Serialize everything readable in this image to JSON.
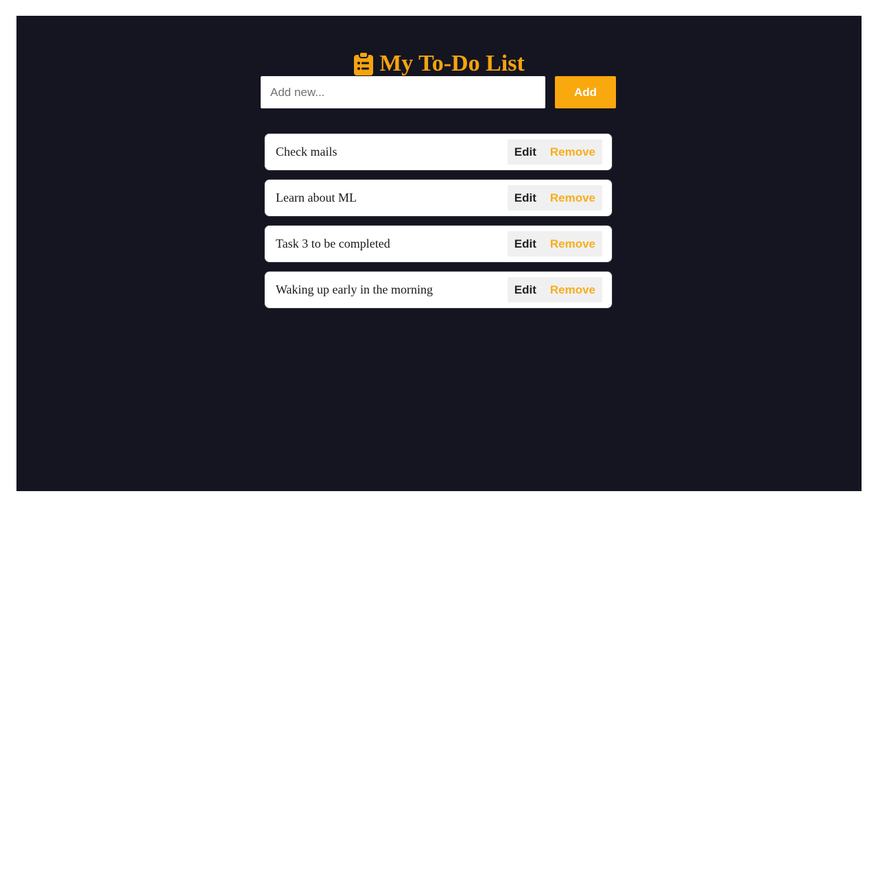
{
  "app": {
    "title": "My To-Do List",
    "title_icon": "clipboard-list-icon",
    "accent_color": "#f5a30f",
    "background_color": "#141520"
  },
  "add_form": {
    "placeholder": "Add new...",
    "value": "",
    "button_label": "Add"
  },
  "todos": [
    {
      "text": "Check mails",
      "edit_label": "Edit",
      "remove_label": "Remove"
    },
    {
      "text": "Learn about ML",
      "edit_label": "Edit",
      "remove_label": "Remove"
    },
    {
      "text": "Task 3 to be completed",
      "edit_label": "Edit",
      "remove_label": "Remove"
    },
    {
      "text": "Waking up early in the morning",
      "edit_label": "Edit",
      "remove_label": "Remove"
    }
  ]
}
